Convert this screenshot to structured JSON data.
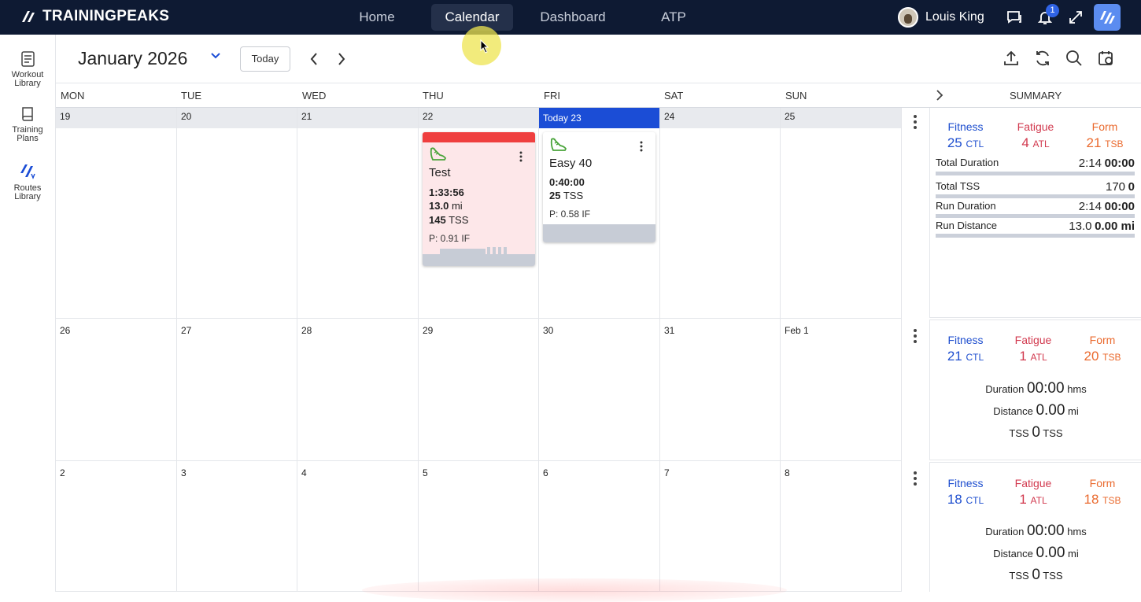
{
  "topbar": {
    "brand": "TRAININGPEAKS",
    "tabs": [
      "Home",
      "Calendar",
      "Dashboard",
      "ATP"
    ],
    "active_tab": "Calendar",
    "user_name": "Louis King",
    "notification_count": "1"
  },
  "sidebar": {
    "items": [
      {
        "label1": "Workout",
        "label2": "Library"
      },
      {
        "label1": "Training",
        "label2": "Plans"
      },
      {
        "label1": "Routes",
        "label2": "Library"
      }
    ]
  },
  "header": {
    "month": "January 2026",
    "today_button": "Today"
  },
  "weekdays": [
    "MON",
    "TUE",
    "WED",
    "THU",
    "FRI",
    "SAT",
    "SUN"
  ],
  "summary_title": "SUMMARY",
  "weeks": [
    {
      "dates": [
        "19",
        "20",
        "21",
        "22",
        "Today 23",
        "24",
        "25"
      ]
    },
    {
      "dates": [
        "26",
        "27",
        "28",
        "29",
        "30",
        "31",
        "Feb 1"
      ]
    },
    {
      "dates": [
        "2",
        "3",
        "4",
        "5",
        "6",
        "7",
        "8"
      ]
    }
  ],
  "workouts": [
    {
      "title": "Test",
      "duration": "1:33:56",
      "distance": "13.0",
      "distance_unit": "mi",
      "tss": "145",
      "tss_unit": "TSS",
      "if": "P: 0.91 IF",
      "status_color": "#ef3f3f",
      "bg": "#fde7e9"
    },
    {
      "title": "Easy 40",
      "duration": "0:40:00",
      "tss": "25",
      "tss_unit": "TSS",
      "if": "P: 0.58 IF",
      "bg": "#ffffff"
    }
  ],
  "summaries": [
    {
      "fitness_label": "Fitness",
      "fitness": "25",
      "fitness_unit": "CTL",
      "fatigue_label": "Fatigue",
      "fatigue": "4",
      "fatigue_unit": "ATL",
      "form_label": "Form",
      "form": "21",
      "form_unit": "TSB",
      "rows": [
        {
          "label": "Total Duration",
          "planned": "2:14",
          "completed": "00:00"
        },
        {
          "label": "Total TSS",
          "planned": "170",
          "completed": "0"
        },
        {
          "label": "Run Duration",
          "planned": "2:14",
          "completed": "00:00"
        },
        {
          "label": "Run Distance",
          "planned": "13.0",
          "completed": "0.00 mi"
        }
      ]
    },
    {
      "fitness_label": "Fitness",
      "fitness": "21",
      "fitness_unit": "CTL",
      "fatigue_label": "Fatigue",
      "fatigue": "1",
      "fatigue_unit": "ATL",
      "form_label": "Form",
      "form": "20",
      "form_unit": "TSB",
      "duration_label": "Duration",
      "duration": "00:00",
      "duration_unit": "hms",
      "distance_label": "Distance",
      "distance": "0.00",
      "distance_unit": "mi",
      "tss_label": "TSS",
      "tss": "0",
      "tss_unit": "TSS"
    },
    {
      "fitness_label": "Fitness",
      "fitness": "18",
      "fitness_unit": "CTL",
      "fatigue_label": "Fatigue",
      "fatigue": "1",
      "fatigue_unit": "ATL",
      "form_label": "Form",
      "form": "18",
      "form_unit": "TSB",
      "duration_label": "Duration",
      "duration": "00:00",
      "duration_unit": "hms",
      "distance_label": "Distance",
      "distance": "0.00",
      "distance_unit": "mi",
      "tss_label": "TSS",
      "tss": "0",
      "tss_unit": "TSS"
    }
  ],
  "colors": {
    "accent": "#1b4dd6",
    "topbar": "#0e1a33",
    "fitness": "#1f4fcf",
    "fatigue": "#d23a4f",
    "form": "#ea6a2e"
  }
}
